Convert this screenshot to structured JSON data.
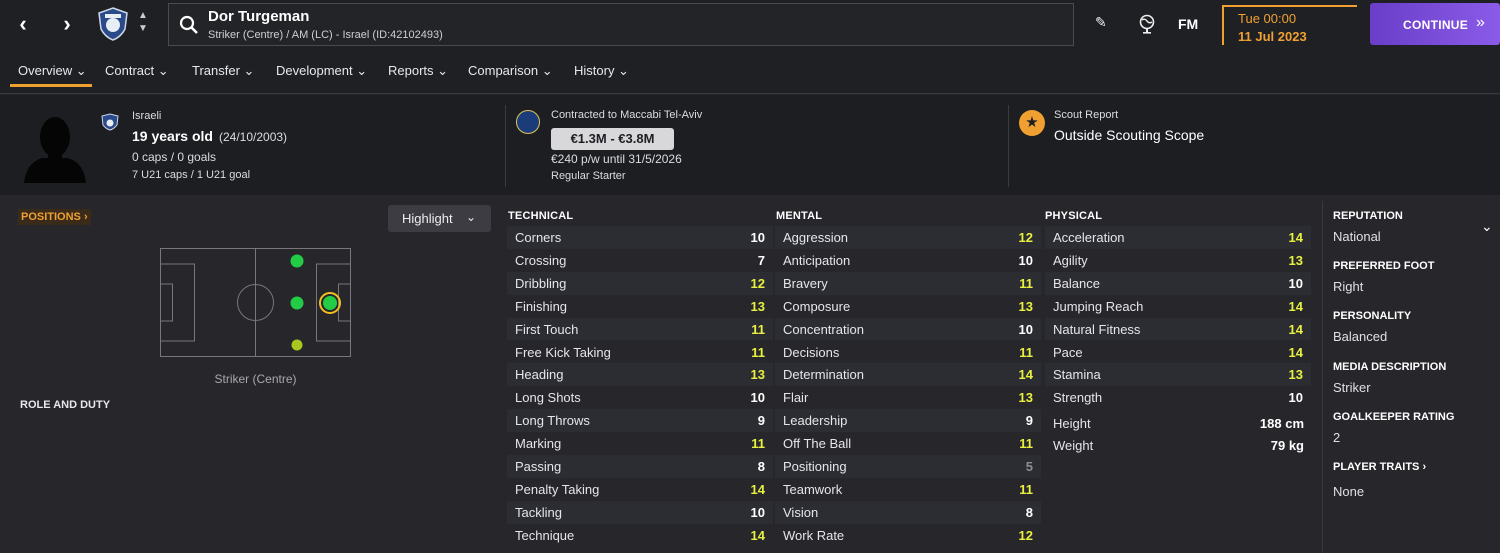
{
  "header": {
    "player_name": "Dor Turgeman",
    "player_subtitle": "Striker (Centre) / AM (LC) - Israel (ID:42102493)",
    "fm_logo": "FM",
    "date_day": "Tue 00:00",
    "date_date": "11 Jul 2023",
    "continue_label": "CONTINUE",
    "icons": [
      "back-arrow-icon",
      "forward-arrow-icon",
      "israel-fa-crest-icon",
      "up-down-icon",
      "search-icon",
      "edit-pencil-icon",
      "world-icon"
    ]
  },
  "tabs": [
    {
      "label": "Overview ⌄"
    },
    {
      "label": "Contract ⌄"
    },
    {
      "label": "Transfer ⌄"
    },
    {
      "label": "Development ⌄"
    },
    {
      "label": "Reports ⌄"
    },
    {
      "label": "Comparison ⌄"
    },
    {
      "label": "History ⌄"
    }
  ],
  "info": {
    "nationality": "Israeli",
    "age": "19 years old",
    "dob": "(24/10/2003)",
    "caps": "0 caps / 0 goals",
    "u21_caps": "7 U21 caps / 1 U21 goal",
    "contract_club": "Contracted to Maccabi Tel-Aviv",
    "value_range": "€1.3M - €3.8M",
    "wage": "€240 p/w until 31/5/2026",
    "status": "Regular Starter",
    "scout_title": "Scout Report",
    "scout_value": "Outside Scouting Scope"
  },
  "positions": {
    "heading": "POSITIONS ›",
    "highlight_label": "Highlight",
    "caption": "Striker (Centre)",
    "role_heading": "ROLE AND DUTY"
  },
  "technical": {
    "heading": "TECHNICAL",
    "rows": [
      {
        "name": "Corners",
        "value": "10"
      },
      {
        "name": "Crossing",
        "value": "7"
      },
      {
        "name": "Dribbling",
        "value": "12"
      },
      {
        "name": "Finishing",
        "value": "13"
      },
      {
        "name": "First Touch",
        "value": "11"
      },
      {
        "name": "Free Kick Taking",
        "value": "11"
      },
      {
        "name": "Heading",
        "value": "13"
      },
      {
        "name": "Long Shots",
        "value": "10"
      },
      {
        "name": "Long Throws",
        "value": "9"
      },
      {
        "name": "Marking",
        "value": "11"
      },
      {
        "name": "Passing",
        "value": "8"
      },
      {
        "name": "Penalty Taking",
        "value": "14"
      },
      {
        "name": "Tackling",
        "value": "10"
      },
      {
        "name": "Technique",
        "value": "14"
      }
    ]
  },
  "mental": {
    "heading": "MENTAL",
    "rows": [
      {
        "name": "Aggression",
        "value": "12"
      },
      {
        "name": "Anticipation",
        "value": "10"
      },
      {
        "name": "Bravery",
        "value": "11"
      },
      {
        "name": "Composure",
        "value": "13"
      },
      {
        "name": "Concentration",
        "value": "10"
      },
      {
        "name": "Decisions",
        "value": "11"
      },
      {
        "name": "Determination",
        "value": "14"
      },
      {
        "name": "Flair",
        "value": "13"
      },
      {
        "name": "Leadership",
        "value": "9"
      },
      {
        "name": "Off The Ball",
        "value": "11"
      },
      {
        "name": "Positioning",
        "value": "5"
      },
      {
        "name": "Teamwork",
        "value": "11"
      },
      {
        "name": "Vision",
        "value": "8"
      },
      {
        "name": "Work Rate",
        "value": "12"
      }
    ]
  },
  "physical": {
    "heading": "PHYSICAL",
    "rows": [
      {
        "name": "Acceleration",
        "value": "14"
      },
      {
        "name": "Agility",
        "value": "13"
      },
      {
        "name": "Balance",
        "value": "10"
      },
      {
        "name": "Jumping Reach",
        "value": "14"
      },
      {
        "name": "Natural Fitness",
        "value": "14"
      },
      {
        "name": "Pace",
        "value": "14"
      },
      {
        "name": "Stamina",
        "value": "13"
      },
      {
        "name": "Strength",
        "value": "10"
      }
    ],
    "height_label": "Height",
    "height_value": "188 cm",
    "weight_label": "Weight",
    "weight_value": "79 kg"
  },
  "side": {
    "reputation_head": "REPUTATION",
    "reputation": "National",
    "foot_head": "PREFERRED FOOT",
    "foot": "Right",
    "personality_head": "PERSONALITY",
    "personality": "Balanced",
    "media_head": "MEDIA DESCRIPTION",
    "media": "Striker",
    "gk_head": "GOALKEEPER RATING",
    "gk": "2",
    "traits_head": "PLAYER TRAITS ›",
    "traits": "None"
  },
  "colors": {
    "accent": "#f0a030",
    "continue": "#7a4cd8",
    "good_attr": "#e8f040",
    "natural_pos": "#22cc44",
    "secondary_pos": "#a8c820"
  }
}
